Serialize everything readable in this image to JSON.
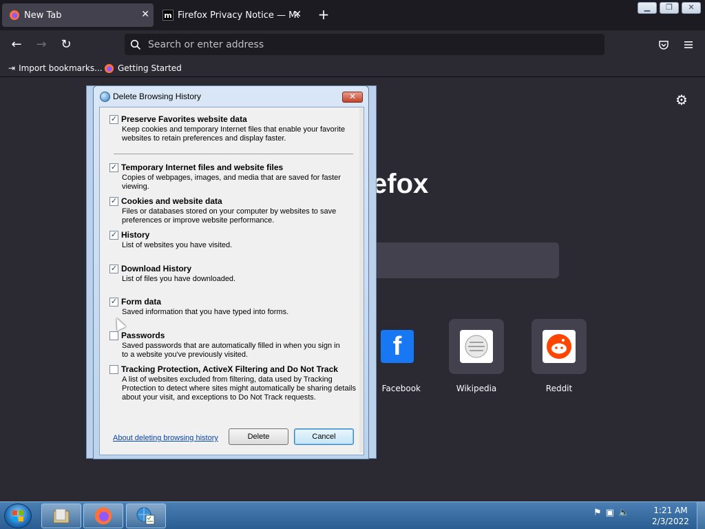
{
  "browser": {
    "tabs": [
      {
        "title": "New Tab",
        "active": true
      },
      {
        "title": "Firefox Privacy Notice — Mozilla",
        "active": false
      }
    ],
    "new_tab_symbol": "+",
    "close_symbol": "✕",
    "address_placeholder": "Search or enter address",
    "bookmarks": [
      {
        "label": "Import bookmarks..."
      },
      {
        "label": "Getting Started"
      }
    ]
  },
  "newtab": {
    "logo_text": "efox",
    "sites": [
      {
        "label": "Facebook",
        "icon": "facebook-icon",
        "color": "#1877f2"
      },
      {
        "label": "Wikipedia",
        "icon": "wikipedia-icon",
        "color": "#ffffff"
      },
      {
        "label": "Reddit",
        "icon": "reddit-icon",
        "color": "#ff4500"
      }
    ]
  },
  "dialog": {
    "title": "Delete Browsing History",
    "close_symbol": "✕",
    "options": [
      {
        "title": "Preserve Favorites website data",
        "desc": "Keep cookies and temporary Internet files that enable your favorite websites to retain preferences and display faster.",
        "checked": true
      },
      {
        "title": "Temporary Internet files and website files",
        "desc": "Copies of webpages, images, and media that are saved for faster viewing.",
        "checked": true
      },
      {
        "title": "Cookies and website data",
        "desc": "Files or databases stored on your computer by websites to save preferences or improve website performance.",
        "checked": true
      },
      {
        "title": "History",
        "desc": "List of websites you have visited.",
        "checked": true
      },
      {
        "title": "Download History",
        "desc": "List of files you have downloaded.",
        "checked": true
      },
      {
        "title": "Form data",
        "desc": "Saved information that you have typed into forms.",
        "checked": true
      },
      {
        "title": "Passwords",
        "desc": "Saved passwords that are automatically filled in when you sign in to a website you've previously visited.",
        "checked": false
      },
      {
        "title": "Tracking Protection, ActiveX Filtering and Do Not Track",
        "desc": "A list of websites excluded from filtering, data used by Tracking Protection to detect where sites might automatically be sharing details about your visit, and exceptions to Do Not Track requests.",
        "checked": false
      }
    ],
    "about_link": "About deleting browsing history",
    "delete_label": "Delete",
    "cancel_label": "Cancel"
  },
  "taskbar": {
    "clock_time": "1:21 AM",
    "clock_date": "2/3/2022"
  }
}
